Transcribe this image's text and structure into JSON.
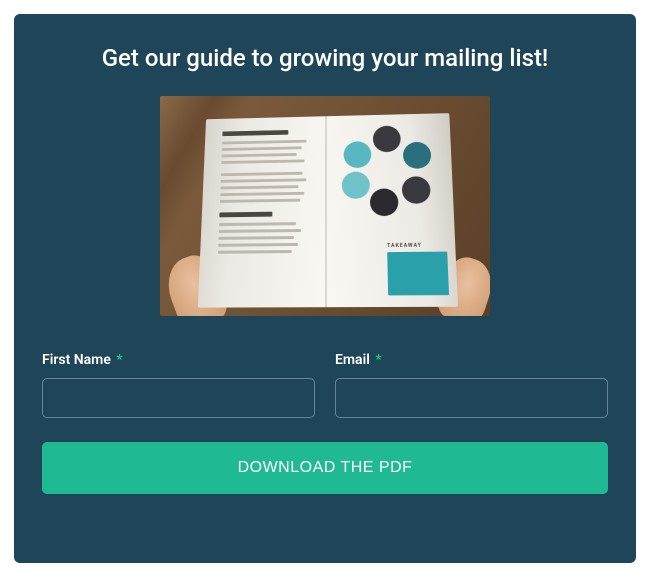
{
  "headline": "Get our guide to growing your mailing list!",
  "image": {
    "takeaway_label": "TAKEAWAY"
  },
  "form": {
    "first_name": {
      "label": "First Name",
      "required_mark": "*",
      "value": ""
    },
    "email": {
      "label": "Email",
      "required_mark": "*",
      "value": ""
    },
    "submit_label": "DOWNLOAD THE PDF"
  },
  "colors": {
    "background": "#1f4558",
    "accent": "#1fb993",
    "required": "#20c28a"
  }
}
